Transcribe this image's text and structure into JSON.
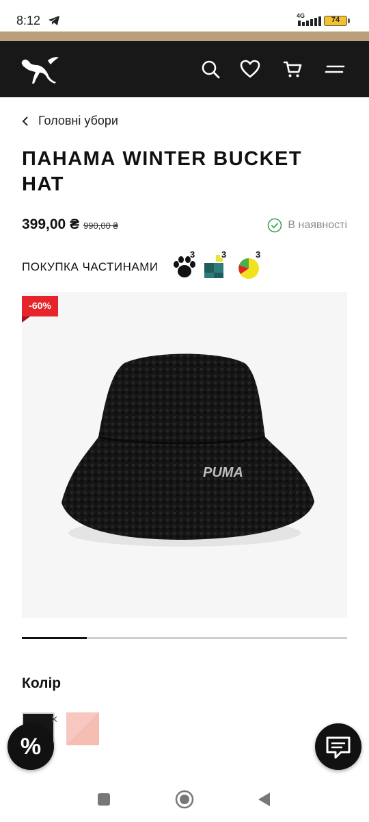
{
  "status_bar": {
    "time": "8:12",
    "network": "4G",
    "battery": "74",
    "icons": [
      "telegram-icon",
      "signal-icon",
      "battery-icon"
    ]
  },
  "header": {
    "brand": "PUMA",
    "icons": [
      "search-icon",
      "heart-icon",
      "cart-icon",
      "menu-icon"
    ],
    "background": "#181818",
    "accent_strip": "#b9a07a"
  },
  "breadcrumb": {
    "label": "Головні убори",
    "icon": "chevron-left-icon"
  },
  "product": {
    "title": "ПАНАМА WINTER BUCKET HAT",
    "price": "399,00 ₴",
    "old_price": "990,00 ₴",
    "availability": "В наявності",
    "discount_badge": "-60%"
  },
  "installment": {
    "label": "ПОКУПКА ЧАСТИНАМИ",
    "options": [
      {
        "icon": "paw-icon",
        "count": "3"
      },
      {
        "icon": "puzzle-icon",
        "count": "3"
      },
      {
        "icon": "pie-chart-icon",
        "count": "3"
      }
    ]
  },
  "gallery": {
    "progress": 0.2
  },
  "colors": {
    "title": "Колір",
    "swatches": [
      {
        "name": "black",
        "color": "#161616",
        "selected": true
      },
      {
        "name": "pink",
        "color": "#f8c7c0",
        "selected": false
      }
    ]
  },
  "fab": {
    "promo_label": "%",
    "chat_icon": "chat-icon"
  },
  "nav_bar": {
    "icons": [
      "recent-apps-icon",
      "home-icon",
      "back-icon"
    ]
  }
}
